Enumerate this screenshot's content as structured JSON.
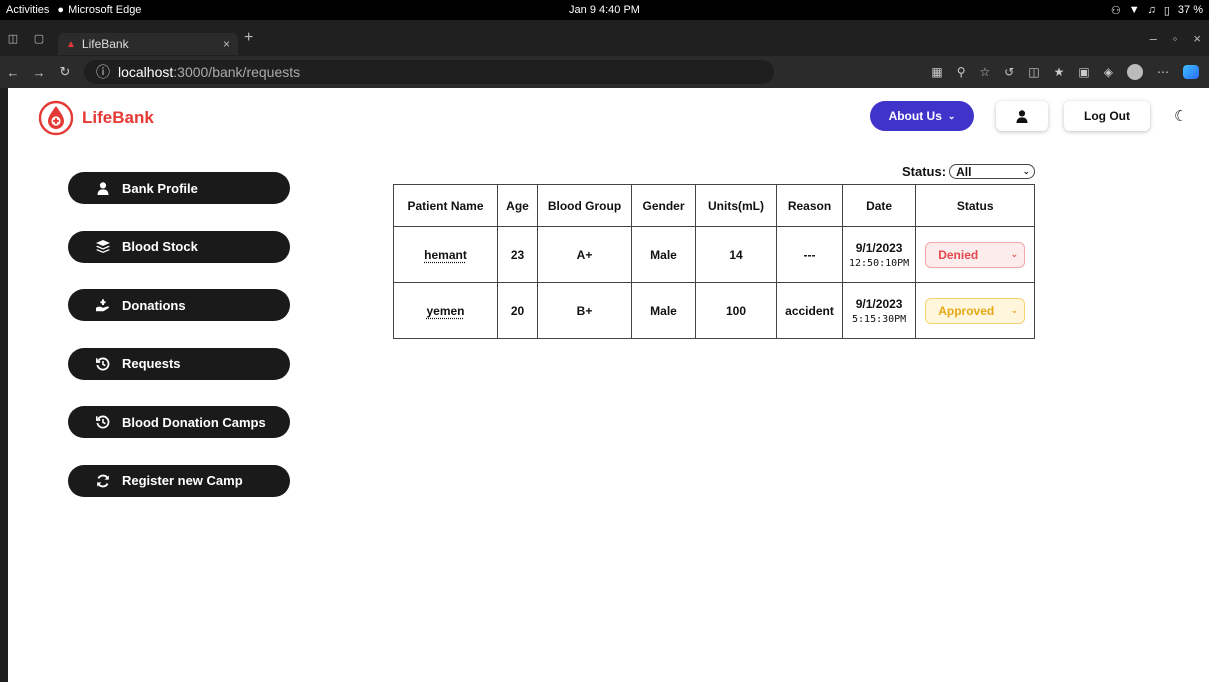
{
  "system_bar": {
    "activities": "Activities",
    "app_name": "Microsoft Edge",
    "clock": "Jan 9  4:40 PM",
    "battery": "37 %"
  },
  "browser": {
    "tab_title": "LifeBank",
    "url_host": "localhost",
    "url_path": ":3000/bank/requests"
  },
  "header": {
    "brand": "LifeBank",
    "about_label": "About Us",
    "logout_label": "Log Out"
  },
  "sidebar": {
    "items": [
      {
        "label": "Bank Profile",
        "icon": "user-icon"
      },
      {
        "label": "Blood Stock",
        "icon": "layers-icon"
      },
      {
        "label": "Donations",
        "icon": "hand-holding-icon"
      },
      {
        "label": "Requests",
        "icon": "history-icon"
      },
      {
        "label": "Blood Donation Camps",
        "icon": "history-icon"
      },
      {
        "label": "Register new Camp",
        "icon": "refresh-icon"
      }
    ]
  },
  "filter": {
    "label": "Status:",
    "value": "All"
  },
  "table": {
    "headers": [
      "Patient Name",
      "Age",
      "Blood Group",
      "Gender",
      "Units(mL)",
      "Reason",
      "Date",
      "Status"
    ],
    "rows": [
      {
        "name": "hemant",
        "age": "23",
        "blood_group": "A+",
        "gender": "Male",
        "units": "14",
        "reason": "---",
        "date": "9/1/2023",
        "time": "12:50:10PM",
        "status": "Denied"
      },
      {
        "name": "yemen",
        "age": "20",
        "blood_group": "B+",
        "gender": "Male",
        "units": "100",
        "reason": "accident",
        "date": "9/1/2023",
        "time": "5:15:30PM",
        "status": "Approved"
      }
    ]
  },
  "colors": {
    "brand_red": "#e53935",
    "about_bg": "#3f33c9",
    "sidebar_btn_bg": "#1a1a1a",
    "denied": "#e5484d",
    "approved": "#e6a817"
  }
}
